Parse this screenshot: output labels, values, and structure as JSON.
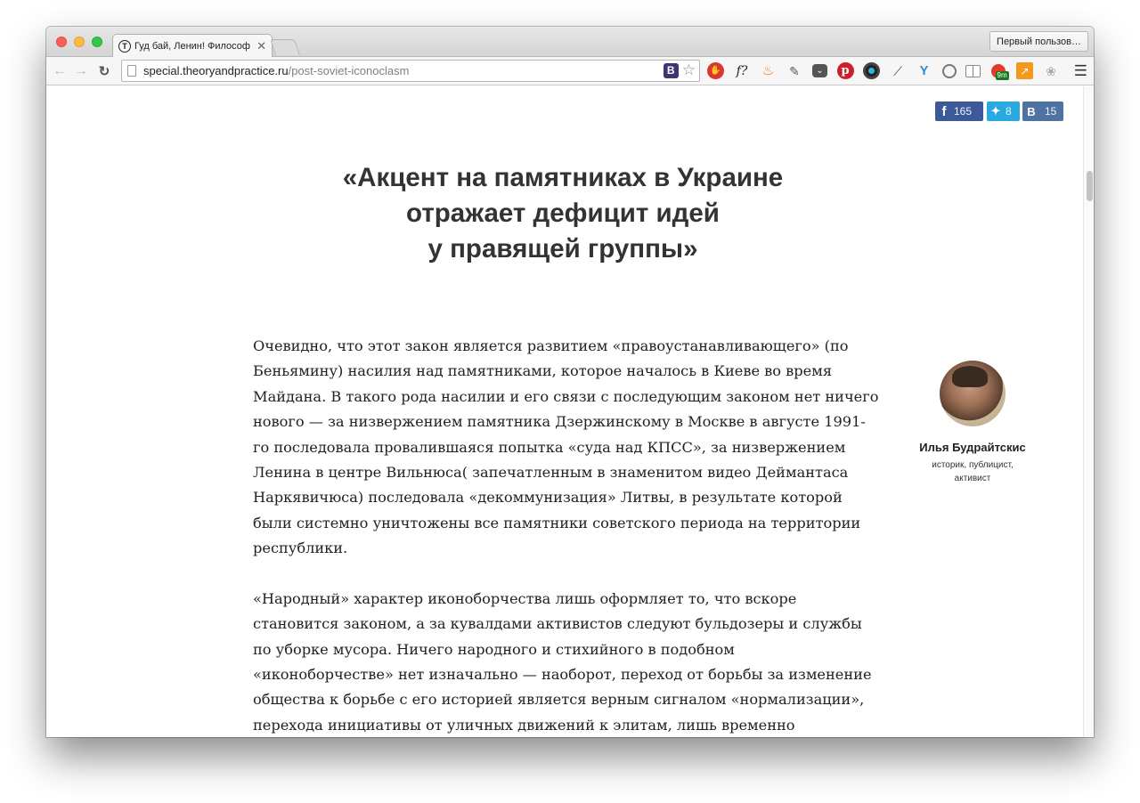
{
  "browser": {
    "tab_title": "Гуд бай, Ленин! Философ",
    "tab_favicon_letter": "T",
    "profile_button": "Первый пользов…",
    "url_host": "special.theoryandpractice.ru",
    "url_path": "/post-soviet-iconoclasm",
    "omnibox_ext_letter": "B",
    "extensions": [
      "adblock-icon",
      "font-finder-icon",
      "fire-icon",
      "evernote-icon",
      "pocket-icon",
      "pinterest-icon",
      "camera-icon",
      "eyedropper-icon",
      "yandex-icon",
      "refresh-circle-icon",
      "reader-icon",
      "rss-badge-icon",
      "chart-icon",
      "paw-icon"
    ],
    "extension_badge": "9m"
  },
  "share": {
    "facebook_count": "165",
    "twitter_count": "8",
    "vk_count": "15",
    "facebook_color": "#3c5a99",
    "twitter_color": "#28a9e0",
    "vk_color": "#4f73a0"
  },
  "article": {
    "headline_lines": [
      "«Акцент на памятниках в Украине",
      "отражает дефицит идей",
      "у правящей группы»"
    ],
    "paragraph1_lines": [
      "Очевидно, что этот закон является развитием «правоустанавливающего» (по",
      "Беньямину) насилия над памятниками, которое началось в Киеве во время",
      "Майдана. В такого рода насилии и его связи с последующим законом нет ничего",
      "нового — за низвержением памятника Дзержинскому в Москве в августе 1991-",
      "го последовала провалившаяся попытка «суда над КПСС», за низвержением",
      "Ленина в центре Вильнюса( запечатленным в знаменитом видео Деймантаса",
      "Наркявичюса) последовала «декоммунизация» Литвы, в результате которой",
      "были системно уничтожены все памятники советского периода на территории",
      "республики."
    ],
    "paragraph2_lines": [
      "«Народный» характер иконоборчества лишь оформляет то, что вскоре",
      "становится законом, а за кувалдами активистов следуют бульдозеры и службы",
      "по уборке мусора. Ничего народного и стихийного в подобном",
      "«иконоборчестве» нет изначально — наоборот, переход от борьбы за изменение",
      "общества к борьбе с его историей является верным сигналом «нормализации»,",
      "перехода инициативы от уличных движений к элитам, лишь временно"
    ]
  },
  "author": {
    "name": "Илья Будрайтскис",
    "description_lines": [
      "историк, публицист,",
      "активист"
    ]
  }
}
